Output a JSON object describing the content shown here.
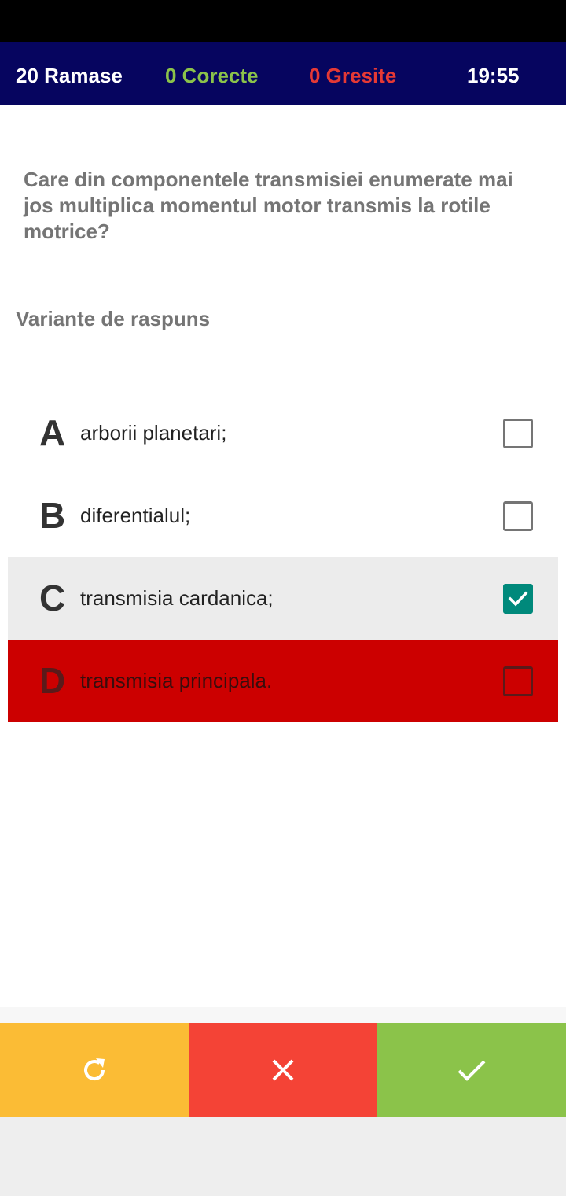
{
  "stats": {
    "remaining": "20 Ramase",
    "correct": "0 Corecte",
    "wrong": "0 Gresite",
    "timer": "19:55"
  },
  "question": {
    "text": "Care din componentele transmisiei enumerate mai jos multiplica momentul motor transmis la rotile motrice?"
  },
  "answers": {
    "heading": "Variante de raspuns",
    "options": [
      {
        "letter": "A",
        "text": "arborii planetari;",
        "checked": false,
        "state": "default"
      },
      {
        "letter": "B",
        "text": "diferentialul;",
        "checked": false,
        "state": "default"
      },
      {
        "letter": "C",
        "text": "transmisia cardanica;",
        "checked": true,
        "state": "selected"
      },
      {
        "letter": "D",
        "text": "transmisia principala.",
        "checked": false,
        "state": "wrong"
      }
    ]
  },
  "actions": {
    "reset_icon": "refresh-icon",
    "cancel_icon": "close-icon",
    "confirm_icon": "check-icon"
  },
  "colors": {
    "header_bg": "#06055f",
    "correct": "#8bc34a",
    "wrong": "#e53935",
    "wrong_row": "#cc0000",
    "selected_row": "#ececec",
    "checkbox_checked": "#00897b",
    "reset_button": "#fbbc35",
    "cancel_button": "#f44336",
    "confirm_button": "#8bc34a"
  }
}
